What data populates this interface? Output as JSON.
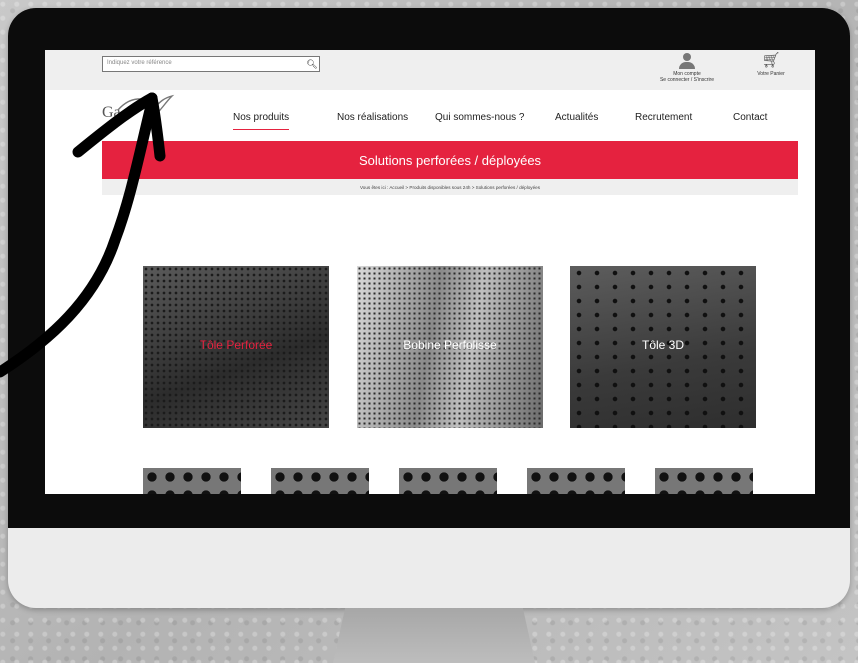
{
  "topbar": {
    "search_placeholder": "Indiquez votre référence",
    "account_label": "Mon compte",
    "account_sublabel": "Se connecter / S'inscrire",
    "cart_label": "Votre Panier"
  },
  "logo": {
    "text": "Ga"
  },
  "nav": {
    "items": [
      {
        "label": "Nos produits",
        "active": true
      },
      {
        "label": "Nos réalisations"
      },
      {
        "label": "Qui sommes-nous ?"
      },
      {
        "label": "Actualités"
      },
      {
        "label": "Recrutement"
      },
      {
        "label": "Contact"
      }
    ]
  },
  "banner": {
    "title": "Solutions perforées / déployées"
  },
  "breadcrumb": {
    "text": "Vous êtes ici : Accueil > Produits disponibles sous 24h > Solutions perforées / déployées"
  },
  "products": [
    {
      "label": "Tôle Perforée"
    },
    {
      "label": "Bobine Perfolisse"
    },
    {
      "label": "Tôle 3D"
    }
  ],
  "colors": {
    "accent": "#e5223f",
    "bezel": "#0c0c0c"
  }
}
